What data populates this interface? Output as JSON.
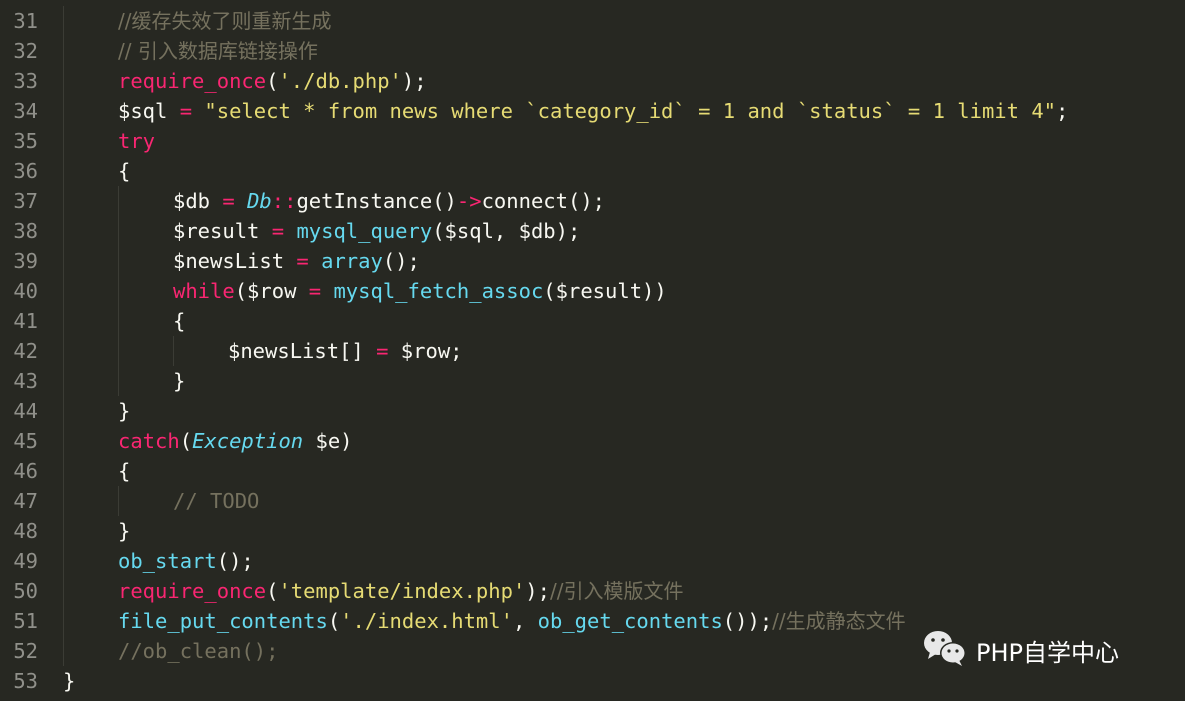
{
  "editor": {
    "theme_colors": {
      "background": "#272822",
      "line_number": "#90908a",
      "comment": "#75715e",
      "keyword": "#f92672",
      "function": "#66d9ef",
      "string": "#e6db74",
      "text": "#f8f8f2"
    },
    "lines": [
      {
        "num": "31",
        "indent": 1,
        "tokens": [
          {
            "t": "cm",
            "v": "//缓存失效了则重新生成"
          }
        ]
      },
      {
        "num": "32",
        "indent": 1,
        "tokens": [
          {
            "t": "cm",
            "v": "// 引入数据库链接操作"
          }
        ]
      },
      {
        "num": "33",
        "indent": 1,
        "tokens": [
          {
            "t": "kw",
            "v": "require_once"
          },
          {
            "t": "tx",
            "v": "("
          },
          {
            "t": "st",
            "v": "'./db.php'"
          },
          {
            "t": "tx",
            "v": ");"
          }
        ]
      },
      {
        "num": "34",
        "indent": 1,
        "tokens": [
          {
            "t": "tx",
            "v": "$sql "
          },
          {
            "t": "op",
            "v": "="
          },
          {
            "t": "tx",
            "v": " "
          },
          {
            "t": "st",
            "v": "\"select * from news where `category_id` = 1 and `status` = 1 limit 4\""
          },
          {
            "t": "tx",
            "v": ";"
          }
        ]
      },
      {
        "num": "35",
        "indent": 1,
        "tokens": [
          {
            "t": "kw",
            "v": "try"
          }
        ]
      },
      {
        "num": "36",
        "indent": 1,
        "tokens": [
          {
            "t": "tx",
            "v": "{"
          }
        ]
      },
      {
        "num": "37",
        "indent": 2,
        "tokens": [
          {
            "t": "tx",
            "v": "$db "
          },
          {
            "t": "op",
            "v": "="
          },
          {
            "t": "tx",
            "v": " "
          },
          {
            "t": "cl",
            "v": "Db"
          },
          {
            "t": "op",
            "v": "::"
          },
          {
            "t": "tx",
            "v": "getInstance()"
          },
          {
            "t": "op",
            "v": "->"
          },
          {
            "t": "tx",
            "v": "connect();"
          }
        ]
      },
      {
        "num": "38",
        "indent": 2,
        "tokens": [
          {
            "t": "tx",
            "v": "$result "
          },
          {
            "t": "op",
            "v": "="
          },
          {
            "t": "tx",
            "v": " "
          },
          {
            "t": "fn",
            "v": "mysql_query"
          },
          {
            "t": "tx",
            "v": "($sql, $db);"
          }
        ]
      },
      {
        "num": "39",
        "indent": 2,
        "tokens": [
          {
            "t": "tx",
            "v": "$newsList "
          },
          {
            "t": "op",
            "v": "="
          },
          {
            "t": "tx",
            "v": " "
          },
          {
            "t": "fn",
            "v": "array"
          },
          {
            "t": "tx",
            "v": "();"
          }
        ]
      },
      {
        "num": "40",
        "indent": 2,
        "tokens": [
          {
            "t": "kw",
            "v": "while"
          },
          {
            "t": "tx",
            "v": "($row "
          },
          {
            "t": "op",
            "v": "="
          },
          {
            "t": "tx",
            "v": " "
          },
          {
            "t": "fn",
            "v": "mysql_fetch_assoc"
          },
          {
            "t": "tx",
            "v": "($result))"
          }
        ]
      },
      {
        "num": "41",
        "indent": 2,
        "tokens": [
          {
            "t": "tx",
            "v": "{"
          }
        ]
      },
      {
        "num": "42",
        "indent": 3,
        "tokens": [
          {
            "t": "tx",
            "v": "$newsList[] "
          },
          {
            "t": "op",
            "v": "="
          },
          {
            "t": "tx",
            "v": " $row;"
          }
        ]
      },
      {
        "num": "43",
        "indent": 2,
        "tokens": [
          {
            "t": "tx",
            "v": "}"
          }
        ]
      },
      {
        "num": "44",
        "indent": 1,
        "tokens": [
          {
            "t": "tx",
            "v": "}"
          }
        ]
      },
      {
        "num": "45",
        "indent": 1,
        "tokens": [
          {
            "t": "kw",
            "v": "catch"
          },
          {
            "t": "tx",
            "v": "("
          },
          {
            "t": "cl",
            "v": "Exception"
          },
          {
            "t": "tx",
            "v": " $e)"
          }
        ]
      },
      {
        "num": "46",
        "indent": 1,
        "tokens": [
          {
            "t": "tx",
            "v": "{"
          }
        ]
      },
      {
        "num": "47",
        "indent": 2,
        "tokens": [
          {
            "t": "cm",
            "v": "// TODO"
          }
        ]
      },
      {
        "num": "48",
        "indent": 1,
        "tokens": [
          {
            "t": "tx",
            "v": "}"
          }
        ]
      },
      {
        "num": "49",
        "indent": 1,
        "tokens": [
          {
            "t": "fn",
            "v": "ob_start"
          },
          {
            "t": "tx",
            "v": "();"
          }
        ]
      },
      {
        "num": "50",
        "indent": 1,
        "tokens": [
          {
            "t": "kw",
            "v": "require_once"
          },
          {
            "t": "tx",
            "v": "("
          },
          {
            "t": "st",
            "v": "'template/index.php'"
          },
          {
            "t": "tx",
            "v": ");"
          },
          {
            "t": "cm",
            "v": "//引入模版文件"
          }
        ]
      },
      {
        "num": "51",
        "indent": 1,
        "tokens": [
          {
            "t": "fn",
            "v": "file_put_contents"
          },
          {
            "t": "tx",
            "v": "("
          },
          {
            "t": "st",
            "v": "'./index.html'"
          },
          {
            "t": "tx",
            "v": ", "
          },
          {
            "t": "fn",
            "v": "ob_get_contents"
          },
          {
            "t": "tx",
            "v": "());"
          },
          {
            "t": "cm",
            "v": "//生成静态文件"
          }
        ]
      },
      {
        "num": "52",
        "indent": 1,
        "tokens": [
          {
            "t": "cm",
            "v": "//ob_clean();"
          }
        ]
      },
      {
        "num": "53",
        "indent": 0,
        "tokens": [
          {
            "t": "tx",
            "v": "}"
          }
        ]
      }
    ]
  },
  "watermark": {
    "icon": "wechat-icon",
    "label": "PHP自学中心"
  }
}
